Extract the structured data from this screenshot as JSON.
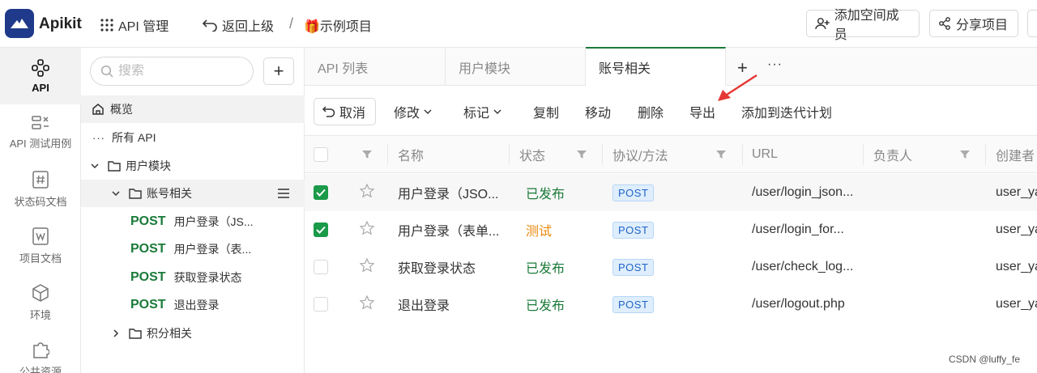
{
  "app": {
    "name": "Apikit",
    "nav_api_manage": "API 管理",
    "nav_back": "返回上级",
    "breadcrumb_sep": "/",
    "project_name": "🎁示例项目",
    "add_member": "添加空间成员",
    "share_project": "分享项目"
  },
  "rail": [
    {
      "label": "API",
      "icon": "api-icon"
    },
    {
      "label": "API 测试用例",
      "icon": "test-case-icon"
    },
    {
      "label": "状态码文档",
      "icon": "status-code-doc-icon"
    },
    {
      "label": "项目文档",
      "icon": "project-doc-icon"
    },
    {
      "label": "环境",
      "icon": "environment-icon"
    },
    {
      "label": "公共资源",
      "icon": "puzzle-icon"
    }
  ],
  "tree": {
    "search_placeholder": "搜索",
    "add_label": "+",
    "overview": "概览",
    "all_api": "所有 API",
    "user_module": "用户模块",
    "account_related": "账号相关",
    "method_post": "POST",
    "apis": [
      "用户登录（JS...",
      "用户登录（表...",
      "获取登录状态",
      "退出登录"
    ],
    "points_related": "积分相关"
  },
  "tabs": [
    "API 列表",
    "用户模块",
    "账号相关"
  ],
  "tab_add": "+",
  "tab_more": "···",
  "toolbar": {
    "cancel": "取消",
    "modify": "修改",
    "mark": "标记",
    "copy": "复制",
    "move": "移动",
    "delete": "删除",
    "export": "导出",
    "add_iteration": "添加到迭代计划"
  },
  "table": {
    "headers": {
      "name": "名称",
      "status": "状态",
      "protocol": "协议/方法",
      "url": "URL",
      "owner": "负责人",
      "creator": "创建者"
    },
    "rows": [
      {
        "checked": true,
        "name": "用户登录（JSO...",
        "status": "已发布",
        "status_kind": "published",
        "method": "POST",
        "url": "/user/login_json...",
        "creator": "user_ya"
      },
      {
        "checked": true,
        "name": "用户登录（表单...",
        "status": "测试",
        "status_kind": "testing",
        "method": "POST",
        "url": "/user/login_for...",
        "creator": "user_ya"
      },
      {
        "checked": false,
        "name": "获取登录状态",
        "status": "已发布",
        "status_kind": "published",
        "method": "POST",
        "url": "/user/check_log...",
        "creator": "user_ya"
      },
      {
        "checked": false,
        "name": "退出登录",
        "status": "已发布",
        "status_kind": "published",
        "method": "POST",
        "url": "/user/logout.php",
        "creator": "user_ya"
      }
    ]
  },
  "watermark": "CSDN @luffy_fe",
  "colors": {
    "brand": "#1f3a8a",
    "accent_green": "#1b7a3a",
    "checkbox_green": "#1b9a4a",
    "status_testing": "#e8890c",
    "method_blue": "#1f64c8",
    "annotation_arrow": "#e53935"
  }
}
